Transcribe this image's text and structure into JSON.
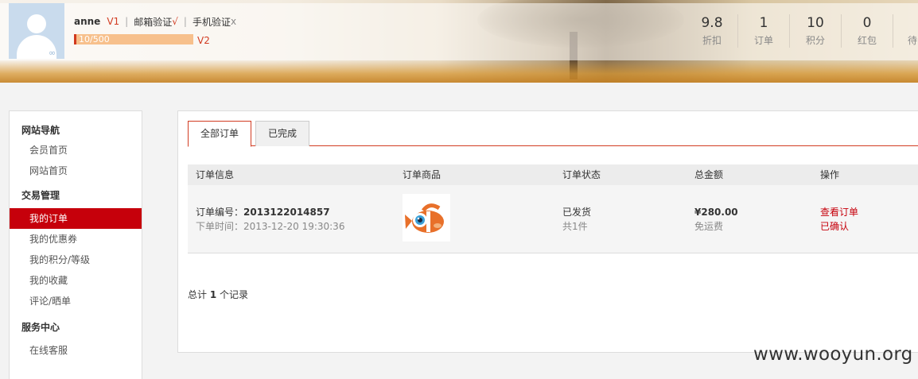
{
  "user": {
    "name": "anne",
    "level": "V1",
    "email_verify": "邮箱验证",
    "email_mark": "√",
    "phone_verify": "手机验证",
    "phone_mark": "x",
    "exp_text": "10/500",
    "exp_progress": 0.02,
    "next_level": "V2"
  },
  "stats": [
    {
      "value": "9.8",
      "label": "折扣"
    },
    {
      "value": "1",
      "label": "订单"
    },
    {
      "value": "10",
      "label": "积分"
    },
    {
      "value": "0",
      "label": "红包"
    },
    {
      "value": "",
      "label": "待"
    }
  ],
  "sidebar": {
    "sections": [
      {
        "title": "网站导航",
        "items": [
          "会员首页",
          "网站首页"
        ]
      },
      {
        "title": "交易管理",
        "items": [
          "我的订单",
          "我的优惠券",
          "我的积分/等级",
          "我的收藏",
          "评论/晒单"
        ]
      },
      {
        "title": "服务中心",
        "items": [
          "在线客服"
        ]
      }
    ],
    "active": "我的订单"
  },
  "tabs": [
    "全部订单",
    "已完成"
  ],
  "table": {
    "headers": [
      "订单信息",
      "订单商品",
      "订单状态",
      "总金额",
      "操作"
    ],
    "rows": [
      {
        "order_label": "订单编号：",
        "order_no": "2013122014857",
        "time": "下单时间：2013-12-20 19:30:36",
        "status": "已发货",
        "count": "共1件",
        "amount": "¥280.00",
        "shipping": "免运费",
        "action_view": "查看订单",
        "action_state": "已确认"
      }
    ]
  },
  "summary": {
    "prefix": "总计",
    "count": "1",
    "suffix": "个记录"
  },
  "watermark": "www.wooyun.org",
  "colors": {
    "accent": "#d23c22",
    "active_bg": "#c6000b",
    "avatar_bg": "#c9dbed"
  }
}
